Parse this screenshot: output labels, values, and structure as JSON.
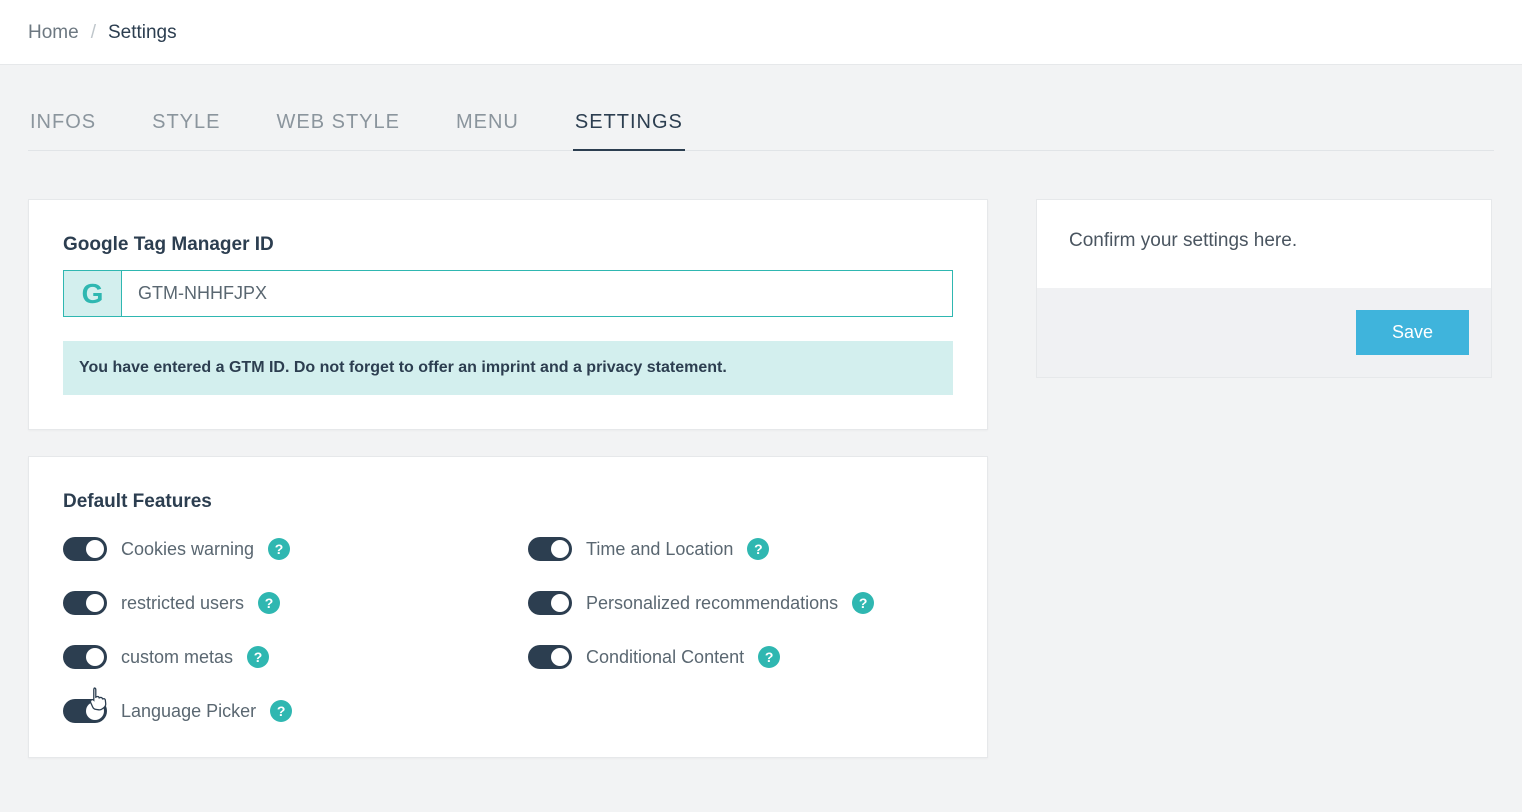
{
  "breadcrumb": {
    "home": "Home",
    "current": "Settings"
  },
  "tabs": [
    {
      "label": "INFOS",
      "active": false
    },
    {
      "label": "STYLE",
      "active": false
    },
    {
      "label": "WEB STYLE",
      "active": false
    },
    {
      "label": "MENU",
      "active": false
    },
    {
      "label": "SETTINGS",
      "active": true
    }
  ],
  "gtm": {
    "title": "Google Tag Manager ID",
    "value": "GTM-NHHFJPX",
    "hint": "You have entered a GTM ID. Do not forget to offer an imprint and a privacy statement."
  },
  "features": {
    "title": "Default Features",
    "left": [
      {
        "label": "Cookies warning",
        "on": true
      },
      {
        "label": "restricted users",
        "on": true
      },
      {
        "label": "custom metas",
        "on": true
      },
      {
        "label": "Language Picker",
        "on": true
      }
    ],
    "right": [
      {
        "label": "Time and Location",
        "on": true
      },
      {
        "label": "Personalized recommendations",
        "on": true
      },
      {
        "label": "Conditional Content",
        "on": true
      }
    ]
  },
  "sidebar": {
    "message": "Confirm your settings here.",
    "save": "Save"
  }
}
